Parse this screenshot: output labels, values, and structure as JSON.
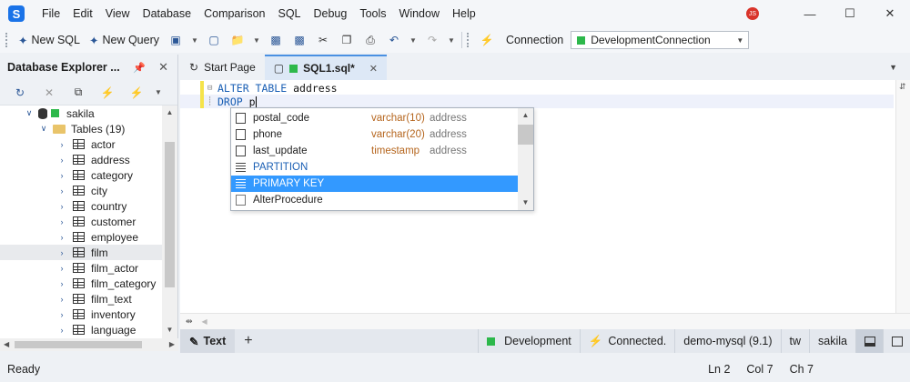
{
  "menu": {
    "logo": "S",
    "items": [
      "File",
      "Edit",
      "View",
      "Database",
      "Comparison",
      "SQL",
      "Debug",
      "Tools",
      "Window",
      "Help"
    ],
    "user_initials": "JS"
  },
  "toolbar": {
    "new_sql_label": "New SQL",
    "new_query_label": "New Query",
    "connection_label": "Connection",
    "connection_value": "DevelopmentConnection"
  },
  "explorer": {
    "title": "Database Explorer ...",
    "database": "sakila",
    "tables_folder": "Tables (19)",
    "tables": [
      "actor",
      "address",
      "category",
      "city",
      "country",
      "customer",
      "employee",
      "film",
      "film_actor",
      "film_category",
      "film_text",
      "inventory",
      "language"
    ],
    "selected_table": "film"
  },
  "tabs": {
    "start_page": "Start Page",
    "sql_tab": "SQL1.sql*"
  },
  "editor": {
    "line1_keyword": "ALTER TABLE",
    "line1_ident": "address",
    "line2_keyword": "DROP",
    "line2_ident": "p"
  },
  "autocomplete": {
    "items": [
      {
        "name": "postal_code",
        "type": "varchar(10)",
        "owner": "address",
        "kind": "column"
      },
      {
        "name": "phone",
        "type": "varchar(20)",
        "owner": "address",
        "kind": "column"
      },
      {
        "name": "last_update",
        "type": "timestamp",
        "owner": "address",
        "kind": "column"
      },
      {
        "name": "PARTITION",
        "type": "",
        "owner": "",
        "kind": "keyword"
      },
      {
        "name": "PRIMARY KEY",
        "type": "",
        "owner": "",
        "kind": "keyword"
      },
      {
        "name": "AlterProcedure",
        "type": "",
        "owner": "",
        "kind": "snippet"
      }
    ],
    "selected_index": 4
  },
  "bottom": {
    "text_tab": "Text",
    "add_symbol": "+",
    "environment": "Development",
    "connection_status": "Connected.",
    "server": "demo-mysql (9.1)",
    "user": "tw",
    "database": "sakila"
  },
  "status": {
    "text": "Ready",
    "line": "Ln 2",
    "col": "Col 7",
    "ch": "Ch 7"
  },
  "colors": {
    "accent": "#3399ff",
    "connected_green": "#2db84b",
    "keyword_blue": "#1a5fb4"
  }
}
